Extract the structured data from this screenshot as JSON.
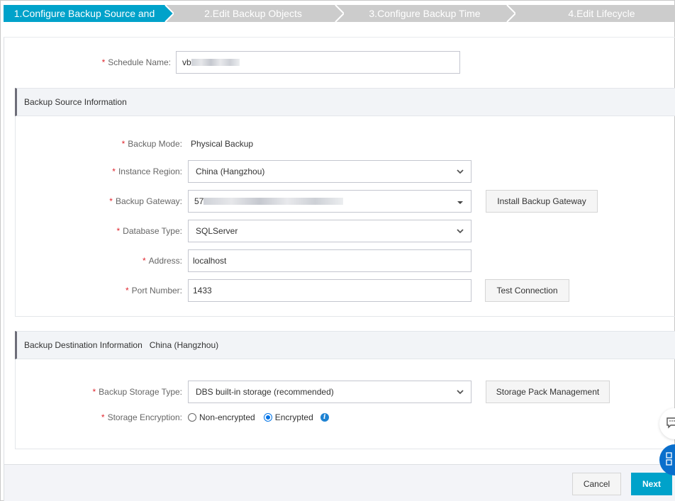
{
  "steps": [
    {
      "label": "1.Configure Backup Source and",
      "active": true
    },
    {
      "label": "2.Edit Backup Objects",
      "active": false
    },
    {
      "label": "3.Configure Backup Time",
      "active": false
    },
    {
      "label": "4.Edit Lifecycle",
      "active": false
    }
  ],
  "schedule": {
    "label": "Schedule Name:",
    "value_prefix": "vb"
  },
  "source": {
    "title": "Backup Source Information",
    "backup_mode": {
      "label": "Backup Mode:",
      "value": "Physical Backup"
    },
    "instance_region": {
      "label": "Instance Region:",
      "value": "China (Hangzhou)"
    },
    "backup_gateway": {
      "label": "Backup Gateway:",
      "value_prefix": "57",
      "button": "Install Backup Gateway"
    },
    "database_type": {
      "label": "Database Type:",
      "value": "SQLServer"
    },
    "address": {
      "label": "Address:",
      "value": "localhost"
    },
    "port": {
      "label": "Port Number:",
      "value": "1433",
      "button": "Test Connection"
    }
  },
  "destination": {
    "title": "Backup Destination Information",
    "region": "China (Hangzhou)",
    "storage_type": {
      "label": "Backup Storage Type:",
      "value": "DBS built-in storage (recommended)",
      "button": "Storage Pack Management"
    },
    "encryption": {
      "label": "Storage Encryption:",
      "options": [
        {
          "label": "Non-encrypted",
          "selected": false
        },
        {
          "label": "Encrypted",
          "selected": true
        }
      ]
    }
  },
  "footer": {
    "cancel": "Cancel",
    "next": "Next"
  },
  "colors": {
    "accent": "#00a2ca",
    "required": "#e0262e",
    "radio_selected": "#0073e6",
    "float_button": "#0a6fcc"
  }
}
